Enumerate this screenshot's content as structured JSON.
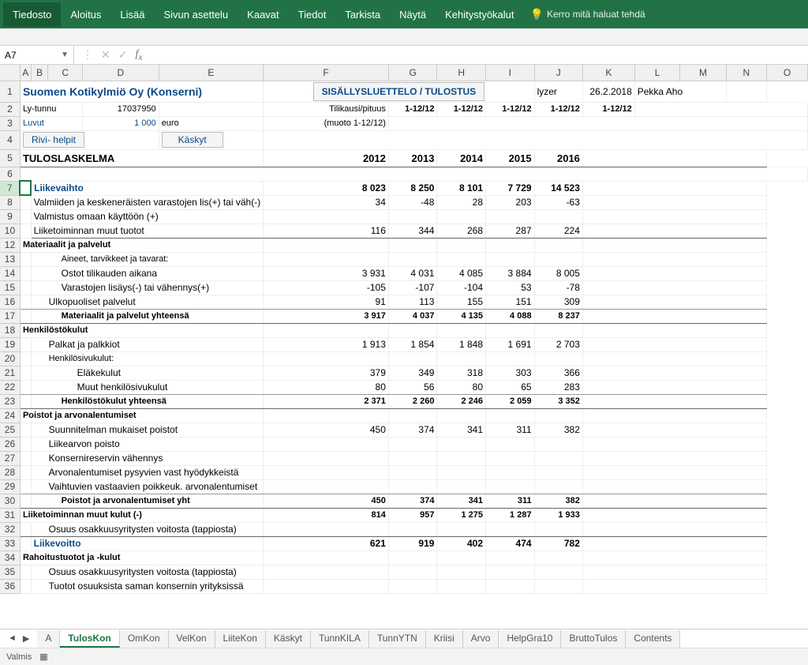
{
  "ribbon": {
    "tabs": [
      "Tiedosto",
      "Aloitus",
      "Lisää",
      "Sivun asettelu",
      "Kaavat",
      "Tiedot",
      "Tarkista",
      "Näytä",
      "Kehitystyökalut"
    ],
    "tell": "Kerro mitä haluat tehdä"
  },
  "namebox": "A7",
  "cols": {
    "A": 14,
    "B": 14,
    "C": 28,
    "D": 62,
    "E": 72,
    "F": 186,
    "G": 68,
    "H": 68,
    "I": 68,
    "J": 68,
    "K": 68,
    "L": 68,
    "M": 68,
    "N": 68,
    "O": 68
  },
  "contentsBtn": "SISÄLLYSLUETTELO / TULOSTUS",
  "meta": {
    "title": "Suomen Kotikylmiö Oy (Konserni)",
    "lytLabel": "Ly-tunnu",
    "lytVal": "17037950",
    "tilikausi": "Tilikausi/pituus",
    "period": "1-12/12",
    "lyzer": "lyzer",
    "date": "26.2.2018",
    "author": "Pekka Aho",
    "luvut": "Luvut",
    "luvutVal": "1 000",
    "luvutUnit": "euro",
    "muoto": "(muoto 1-12/12)",
    "btn1": "Rivi- helpit",
    "btn2": "Käskyt",
    "heading": "TULOSLASKELMA"
  },
  "years": [
    "2012",
    "2013",
    "2014",
    "2015",
    "2016"
  ],
  "rows": [
    {
      "n": 7,
      "label": "Liikevaihto",
      "cls": "hdr",
      "v": [
        "8 023",
        "8 250",
        "8 101",
        "7 729",
        "14 523"
      ]
    },
    {
      "n": 8,
      "label": "Valmiiden ja keskeneräisten varastojen lis(+) tai väh(-)",
      "v": [
        "34",
        "-48",
        "28",
        "203",
        "-63"
      ]
    },
    {
      "n": 9,
      "label": "Valmistus omaan käyttöön (+)",
      "v": [
        "",
        "",
        "",
        "",
        ""
      ]
    },
    {
      "n": 10,
      "label": "Liiketoiminnan muut tuotot",
      "v": [
        "116",
        "344",
        "268",
        "287",
        "224"
      ],
      "border": "b"
    },
    {
      "n": 12,
      "label": "Materiaalit ja palvelut",
      "cls": "small b",
      "indent": 0
    },
    {
      "n": 13,
      "label": "Aineet, tarvikkeet ja tavarat:",
      "cls": "small",
      "indent": 2
    },
    {
      "n": 14,
      "label": "Ostot tilikauden aikana",
      "v": [
        "3 931",
        "4 031",
        "4 085",
        "3 884",
        "8 005"
      ],
      "indent": 2
    },
    {
      "n": 15,
      "label": "Varastojen lisäys(-) tai vähennys(+)",
      "v": [
        "-105",
        "-107",
        "-104",
        "53",
        "-78"
      ],
      "indent": 2
    },
    {
      "n": 16,
      "label": "Ulkopuoliset palvelut",
      "v": [
        "91",
        "113",
        "155",
        "151",
        "309"
      ],
      "indent": 1,
      "border": "b2"
    },
    {
      "n": 17,
      "label": "Materiaalit ja palvelut yhteensä",
      "cls": "small b",
      "v": [
        "3 917",
        "4 037",
        "4 135",
        "4 088",
        "8 237"
      ],
      "indent": 2,
      "border": "b"
    },
    {
      "n": 18,
      "label": "Henkilöstökulut",
      "cls": "small b",
      "indent": 0
    },
    {
      "n": 19,
      "label": "Palkat ja palkkiot",
      "v": [
        "1 913",
        "1 854",
        "1 848",
        "1 691",
        "2 703"
      ],
      "indent": 1
    },
    {
      "n": 20,
      "label": "Henkilösivukulut:",
      "cls": "small",
      "indent": 1
    },
    {
      "n": 21,
      "label": "Eläkekulut",
      "v": [
        "379",
        "349",
        "318",
        "303",
        "366"
      ],
      "indent": 3
    },
    {
      "n": 22,
      "label": "Muut henkilösivukulut",
      "v": [
        "80",
        "56",
        "80",
        "65",
        "283"
      ],
      "indent": 3,
      "border": "b2"
    },
    {
      "n": 23,
      "label": "Henkilöstökulut yhteensä",
      "cls": "small b",
      "v": [
        "2 371",
        "2 260",
        "2 246",
        "2 059",
        "3 352"
      ],
      "indent": 2,
      "border": "b"
    },
    {
      "n": 24,
      "label": "Poistot ja arvonalentumiset",
      "cls": "small b",
      "indent": 0
    },
    {
      "n": 25,
      "label": "Suunnitelman mukaiset poistot",
      "v": [
        "450",
        "374",
        "341",
        "311",
        "382"
      ],
      "indent": 1
    },
    {
      "n": 26,
      "label": "Liikearvon poisto",
      "indent": 1
    },
    {
      "n": 27,
      "label": "Konsernireservin vähennys",
      "indent": 1
    },
    {
      "n": 28,
      "label": "Arvonalentumiset pysyvien vast hyödykkeistä",
      "indent": 1
    },
    {
      "n": 29,
      "label": "Vaihtuvien vastaavien poikkeuk. arvonalentumiset",
      "indent": 1,
      "border": "b2"
    },
    {
      "n": 30,
      "label": "Poistot ja arvonalentumiset yht",
      "cls": "small b",
      "v": [
        "450",
        "374",
        "341",
        "311",
        "382"
      ],
      "indent": 2,
      "border": "b"
    },
    {
      "n": 31,
      "label": "Liiketoiminnan muut kulut (-)",
      "cls": "small b",
      "v": [
        "814",
        "957",
        "1 275",
        "1 287",
        "1 933"
      ],
      "indent": 0
    },
    {
      "n": 32,
      "label": "Osuus osakkuusyritysten voitosta (tappiosta)",
      "indent": 1,
      "border": "b"
    },
    {
      "n": 33,
      "label": "Liikevoitto",
      "cls": "hdr",
      "v": [
        "621",
        "919",
        "402",
        "474",
        "782"
      ]
    },
    {
      "n": 34,
      "label": "Rahoitustuotot ja -kulut",
      "cls": "small b",
      "indent": 0
    },
    {
      "n": 35,
      "label": "Osuus osakkuusyritysten voitosta (tappiosta)",
      "indent": 1
    },
    {
      "n": 36,
      "label": "Tuotot osuuksista saman konsernin yrityksissä",
      "indent": 1
    }
  ],
  "sheetTabs": [
    "A",
    "TulosKon",
    "OmKon",
    "VelKon",
    "LiiteKon",
    "Käskyt",
    "TunnKILA",
    "TunnYTN",
    "Kriisi",
    "Arvo",
    "HelpGra10",
    "BruttoTulos",
    "Contents"
  ],
  "activeTab": "TulosKon",
  "status": "Valmis"
}
